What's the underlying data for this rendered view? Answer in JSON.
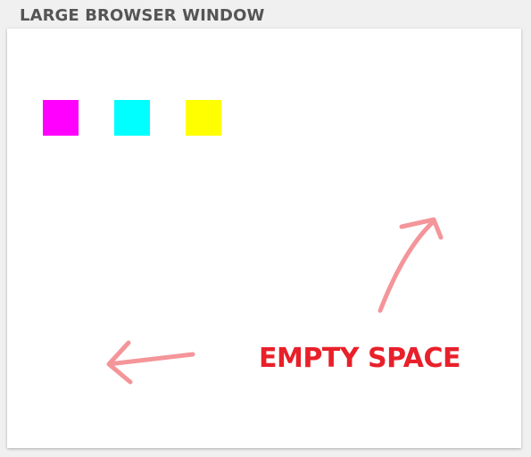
{
  "window": {
    "title": "LARGE BROWSER WINDOW"
  },
  "swatches": [
    {
      "name": "magenta",
      "color": "#ff00ff"
    },
    {
      "name": "cyan",
      "color": "#00ffff"
    },
    {
      "name": "yellow",
      "color": "#ffff00"
    }
  ],
  "annotation": {
    "label": "EMPTY SPACE",
    "label_color": "#e8202a",
    "arrow_color": "#f4959a"
  }
}
